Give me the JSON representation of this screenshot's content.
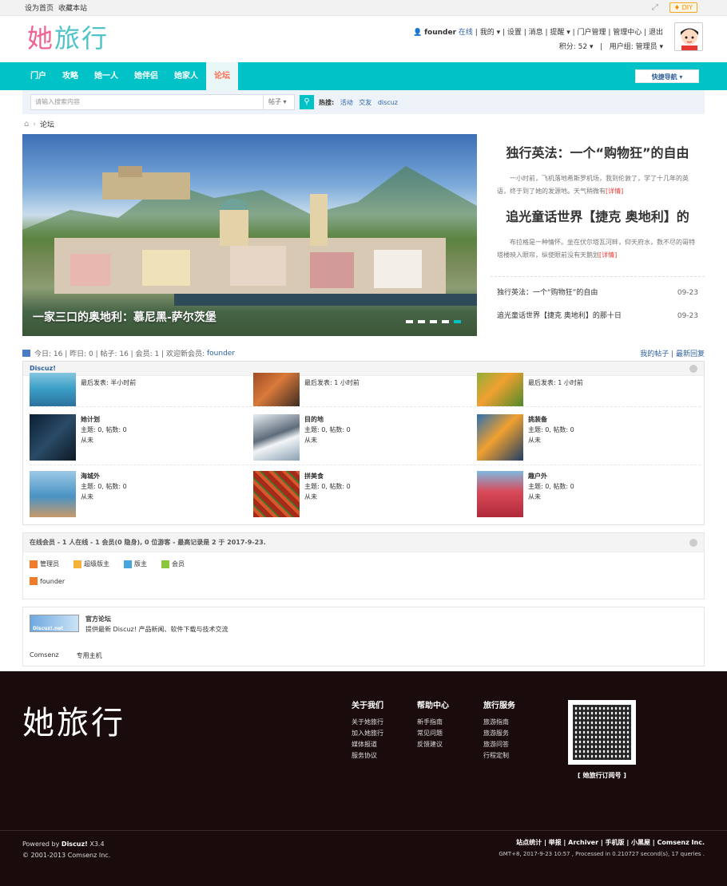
{
  "topbar": {
    "set_home": "设为首页",
    "bookmark": "收藏本站",
    "diy": "♦ DIY"
  },
  "logo": {
    "part1": "她",
    "part2": "旅行"
  },
  "user": {
    "name": "founder",
    "status": "在线",
    "links_line": "我的 ▾ | 设置 | 消息 | 提醒 ▾ | 门户管理 | 管理中心 | 退出",
    "points": "积分: 52 ▾",
    "group": "用户组: 管理员 ▾"
  },
  "nav": {
    "items": [
      "门户",
      "攻略",
      "她一人",
      "她伴侣",
      "她家人",
      "论坛"
    ],
    "quick": "快捷导航 ▾"
  },
  "search": {
    "placeholder": "请输入搜索内容",
    "type": "帖子 ▾",
    "hot_label": "热搜:",
    "hot": [
      "活动",
      "交友",
      "discuz"
    ]
  },
  "breadcrumb": {
    "home": "⌂",
    "sep": "›",
    "current": "论坛"
  },
  "slider": {
    "caption": "一家三口的奥地利：慕尼黑-萨尔茨堡"
  },
  "news": {
    "items": [
      {
        "title": "独行英法：一个“购物狂”的自由",
        "summary": "一小时前，飞机落地希斯罗机场，我到伦敦了，学了十几年的英语，终于到了她的发源地。天气稍微有",
        "more": "[详情]"
      },
      {
        "title": "追光童话世界【捷克 奥地利】的",
        "summary": "布拉格是一种情怀。坐在伏尔塔瓦河畔，仰天府水，数不尽的哥特塔楼映入眼帘，纵使眼前没有天鹅划",
        "more": "[详情]"
      }
    ],
    "list": [
      {
        "title": "独行英法：一个“购物狂”的自由",
        "date": "09-23"
      },
      {
        "title": "追光童话世界【捷克 奥地利】的那十日",
        "date": "09-23"
      }
    ]
  },
  "stats": {
    "text": "今日: 16 | 昨日: 0 | 帖子: 16 | 会员: 1 | 欢迎新会员: ",
    "newuser": "founder",
    "right": "我的帖子 | 最新回复"
  },
  "forum": {
    "title": "Discuz!",
    "first_row": [
      {
        "last": "最后发表: 半小时前"
      },
      {
        "last": "最后发表: 1 小时前"
      },
      {
        "last": "最后发表: 1 小时前"
      }
    ],
    "rows": [
      [
        {
          "name": "她计划",
          "count": "主题: 0, 帖数: 0",
          "last": "从未"
        },
        {
          "name": "目的地",
          "count": "主题: 0, 帖数: 0",
          "last": "从未"
        },
        {
          "name": "挑装备",
          "count": "主题: 0, 帖数: 0",
          "last": "从未"
        }
      ],
      [
        {
          "name": "海城外",
          "count": "主题: 0, 帖数: 0",
          "last": "从未"
        },
        {
          "name": "拼美食",
          "count": "主题: 0, 帖数: 0",
          "last": "从未"
        },
        {
          "name": "趣户外",
          "count": "主题: 0, 帖数: 0",
          "last": "从未"
        }
      ]
    ]
  },
  "online": {
    "title": "在线会员",
    "detail": " - 1 人在线 - 1 会员(0 隐身), 0 位游客 - 最高记录是 2 于 2017-9-23.",
    "legend": [
      "管理员",
      "超级版主",
      "版主",
      "会员"
    ],
    "legend_colors": [
      "#f07b2b",
      "#f5b23b",
      "#45a6e0",
      "#8cc63f"
    ],
    "members": [
      "founder"
    ]
  },
  "links": {
    "logo_text": "Discuz!.net",
    "title": "官方论坛",
    "desc": "提供最新 Discuz! 产品新闻、软件下载与技术交流",
    "bottom": [
      "Comsenz",
      "专用主机"
    ]
  },
  "footer": {
    "logo": "她旅行",
    "cols": [
      {
        "title": "关于我们",
        "items": [
          "关于她旅行",
          "加入她旅行",
          "媒体报道",
          "服务协议"
        ]
      },
      {
        "title": "帮助中心",
        "items": [
          "新手指南",
          "常见问题",
          "反馈建议"
        ]
      },
      {
        "title": "旅行服务",
        "items": [
          "旅游指南",
          "旅游服务",
          "旅游问答",
          "行程定制"
        ]
      }
    ],
    "qr_label": "[ 她旅行订阅号 ]",
    "powered": "Powered by ",
    "powered_brand": "Discuz!",
    "version": " X3.4",
    "copyright": "© 2001-2013 Comsenz Inc.",
    "links": "站点统计 | 举报 | Archiver | 手机版 | 小黑屋 | Comsenz Inc.",
    "info": "GMT+8, 2017-9-23 10:57 , Processed in 0.210727 second(s), 17 queries ."
  }
}
